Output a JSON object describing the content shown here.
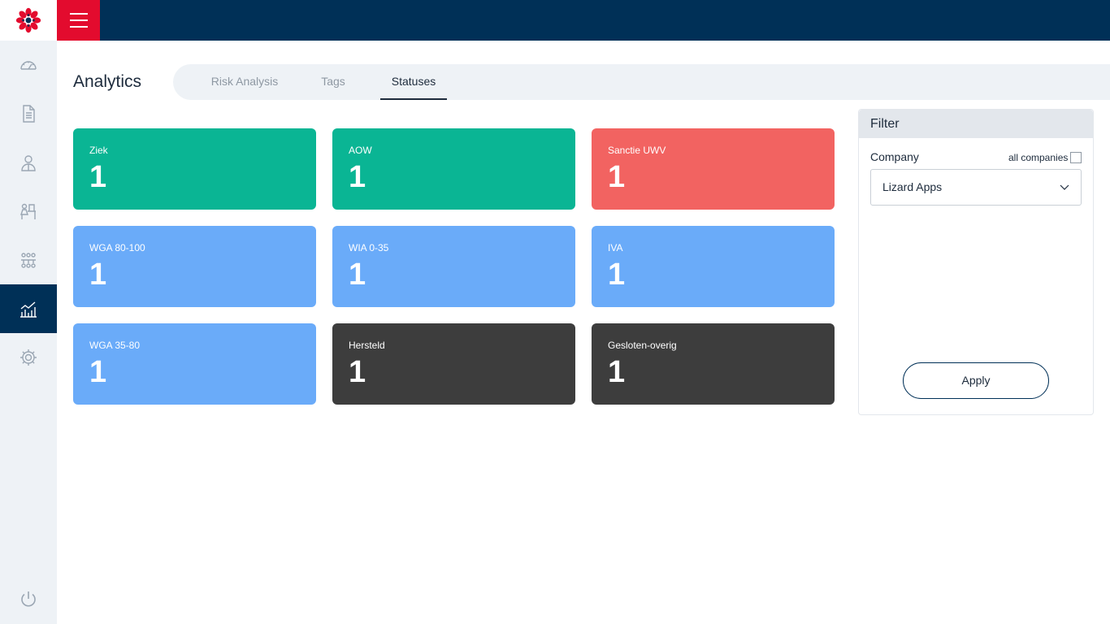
{
  "colors": {
    "navy": "#003057",
    "red": "#e30b2e",
    "green": "#0ab594",
    "salmon": "#f26361",
    "blue": "#6aabf9",
    "dark": "#3d3d3d",
    "sidebar": "#eef2f6"
  },
  "sidebar": {
    "items": [
      {
        "icon": "speedometer-icon"
      },
      {
        "icon": "document-icon"
      },
      {
        "icon": "person-icon"
      },
      {
        "icon": "workstation-icon"
      },
      {
        "icon": "team-icon"
      },
      {
        "icon": "analytics-chart-icon",
        "active": true
      },
      {
        "icon": "gear-icon"
      }
    ],
    "logout_icon": "power-icon"
  },
  "page": {
    "title": "Analytics"
  },
  "tabs": [
    {
      "label": "Risk Analysis"
    },
    {
      "label": "Tags"
    },
    {
      "label": "Statuses",
      "active": true
    }
  ],
  "cards": [
    {
      "label": "Ziek",
      "value": "1",
      "color": "green"
    },
    {
      "label": "AOW",
      "value": "1",
      "color": "green"
    },
    {
      "label": "Sanctie UWV",
      "value": "1",
      "color": "salmon"
    },
    {
      "label": "WGA 80-100",
      "value": "1",
      "color": "blue"
    },
    {
      "label": "WIA 0-35",
      "value": "1",
      "color": "blue"
    },
    {
      "label": "IVA",
      "value": "1",
      "color": "blue"
    },
    {
      "label": "WGA 35-80",
      "value": "1",
      "color": "blue"
    },
    {
      "label": "Hersteld",
      "value": "1",
      "color": "dark"
    },
    {
      "label": "Gesloten-overig",
      "value": "1",
      "color": "dark"
    }
  ],
  "filter": {
    "title": "Filter",
    "company_label": "Company",
    "all_companies_label": "all companies",
    "all_companies_checked": false,
    "company_value": "Lizard Apps",
    "apply_label": "Apply"
  }
}
